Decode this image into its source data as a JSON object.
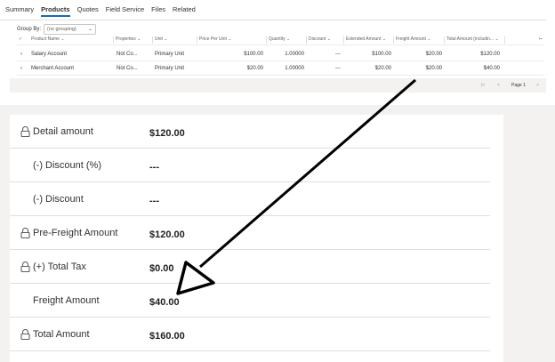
{
  "tabs": [
    "Summary",
    "Products",
    "Quotes",
    "Field Service",
    "Files",
    "Related"
  ],
  "active_tab": "Products",
  "groupby": {
    "label": "Group By:",
    "value": "(no grouping)"
  },
  "columns": [
    "Product Name",
    "Properties",
    "Unit",
    "Price Per Unit",
    "Quantity",
    "Discount",
    "Extended Amount",
    "Freight Amount",
    "Total Amount (includin..."
  ],
  "rows": [
    {
      "name": "Salary Account",
      "properties": "Not Co...",
      "unit": "Primary Unit",
      "price": "$100.00",
      "qty": "1.00000",
      "discount": "---",
      "extended": "$100.00",
      "freight": "$20.00",
      "total": "$120.00"
    },
    {
      "name": "Merchant Account",
      "properties": "Not Co...",
      "unit": "Primary Unit",
      "price": "$20.00",
      "qty": "1.00000",
      "discount": "---",
      "extended": "$20.00",
      "freight": "$20.00",
      "total": "$40.00"
    }
  ],
  "pager": {
    "first": "|<",
    "prev": "<",
    "label": "Page 1",
    "next": ">"
  },
  "summary": [
    {
      "label": "Detail amount",
      "value": "$120.00",
      "locked": true
    },
    {
      "label": "(-) Discount (%)",
      "value": "---",
      "locked": false
    },
    {
      "label": "(-) Discount",
      "value": "---",
      "locked": false
    },
    {
      "label": "Pre-Freight Amount",
      "value": "$120.00",
      "locked": true
    },
    {
      "label": "(+) Total Tax",
      "value": "$0.00",
      "locked": true
    },
    {
      "label": "Freight Amount",
      "value": "$40.00",
      "locked": false
    },
    {
      "label": "Total Amount",
      "value": "$160.00",
      "locked": true
    }
  ],
  "colors": {
    "accent": "#0f6cbd",
    "border": "#e1dfdd",
    "text": "#323130",
    "arrow": "#000000"
  }
}
